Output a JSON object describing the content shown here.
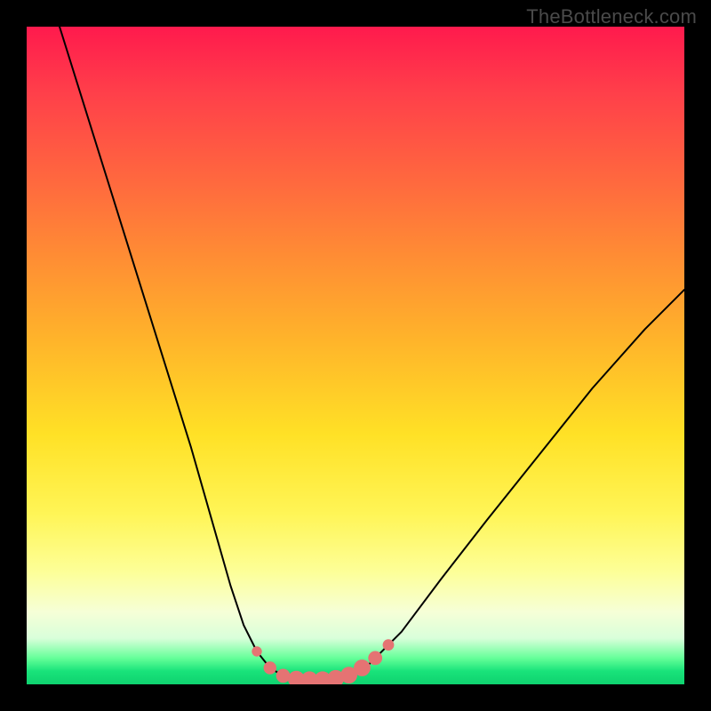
{
  "watermark": "TheBottleneck.com",
  "colors": {
    "frame": "#000000",
    "watermark": "#4a4a4a",
    "curve_stroke": "#000000",
    "marker_fill": "#e57373",
    "marker_stroke": "#e57373"
  },
  "chart_data": {
    "type": "line",
    "title": "",
    "xlabel": "",
    "ylabel": "",
    "xlim": [
      0,
      100
    ],
    "ylim": [
      0,
      100
    ],
    "grid": false,
    "legend": false,
    "annotations": [
      "TheBottleneck.com"
    ],
    "series": [
      {
        "name": "bottleneck-curve",
        "x": [
          5,
          10,
          15,
          20,
          25,
          29,
          31,
          33,
          35,
          37,
          39,
          41,
          43,
          45,
          47,
          49,
          52,
          57,
          63,
          70,
          78,
          86,
          94,
          100
        ],
        "values": [
          100,
          84,
          68,
          52,
          36,
          22,
          15,
          9,
          5,
          2.5,
          1.3,
          0.8,
          0.7,
          0.7,
          0.9,
          1.4,
          3,
          8,
          16,
          25,
          35,
          45,
          54,
          60
        ]
      }
    ],
    "markers": [
      {
        "x": 35,
        "y": 5,
        "r": 0.7
      },
      {
        "x": 37,
        "y": 2.5,
        "r": 0.9
      },
      {
        "x": 39,
        "y": 1.3,
        "r": 1.0
      },
      {
        "x": 41,
        "y": 0.8,
        "r": 1.2
      },
      {
        "x": 43,
        "y": 0.7,
        "r": 1.2
      },
      {
        "x": 45,
        "y": 0.7,
        "r": 1.2
      },
      {
        "x": 47,
        "y": 0.9,
        "r": 1.2
      },
      {
        "x": 49,
        "y": 1.4,
        "r": 1.2
      },
      {
        "x": 51,
        "y": 2.5,
        "r": 1.2
      },
      {
        "x": 53,
        "y": 4.0,
        "r": 1.0
      },
      {
        "x": 55,
        "y": 6.0,
        "r": 0.8
      }
    ]
  }
}
